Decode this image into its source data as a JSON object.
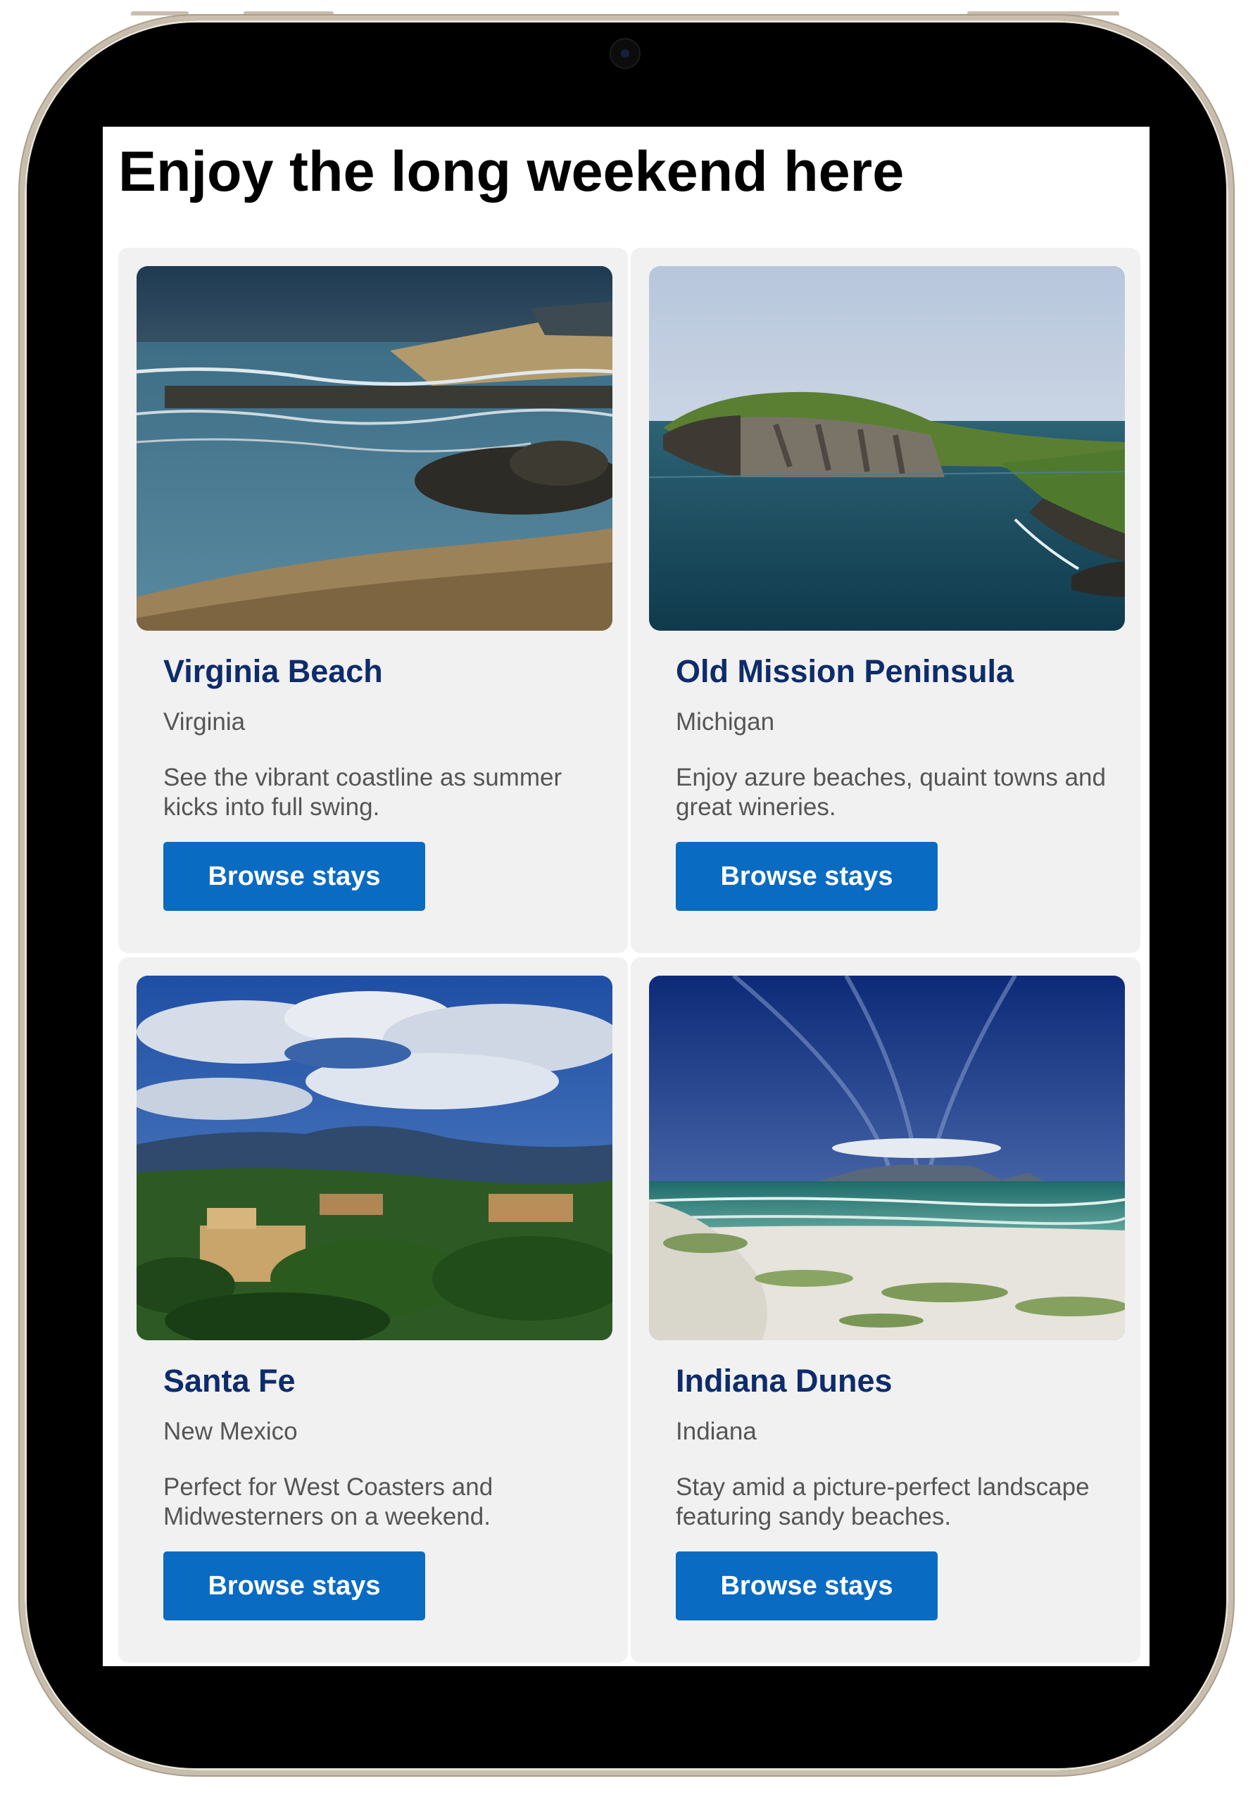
{
  "page": {
    "title": "Enjoy the long weekend here"
  },
  "cards": [
    {
      "title": "Virginia Beach",
      "state": "Virginia",
      "description": "See the vibrant coastline as summer kicks into full swing.",
      "button_label": "Browse stays",
      "image": "beach-coastline-photo"
    },
    {
      "title": "Old Mission Peninsula",
      "state": "Michigan",
      "description": "Enjoy azure beaches, quaint towns and great wineries.",
      "button_label": "Browse stays",
      "image": "green-headland-over-sea-photo"
    },
    {
      "title": "Santa Fe",
      "state": "New Mexico",
      "description": "Perfect for West Coasters and Midwesterners on a weekend.",
      "button_label": "Browse stays",
      "image": "adobe-town-and-mountains-photo"
    },
    {
      "title": "Indiana Dunes",
      "state": "Indiana",
      "description": "Stay amid a picture-perfect landscape featuring sandy beaches.",
      "button_label": "Browse stays",
      "image": "sand-dunes-beach-photo"
    }
  ],
  "colors": {
    "button": "#0a6bc2",
    "card_title": "#0e2c6b",
    "card_background": "#f1f1f1",
    "body_text": "#555555"
  }
}
